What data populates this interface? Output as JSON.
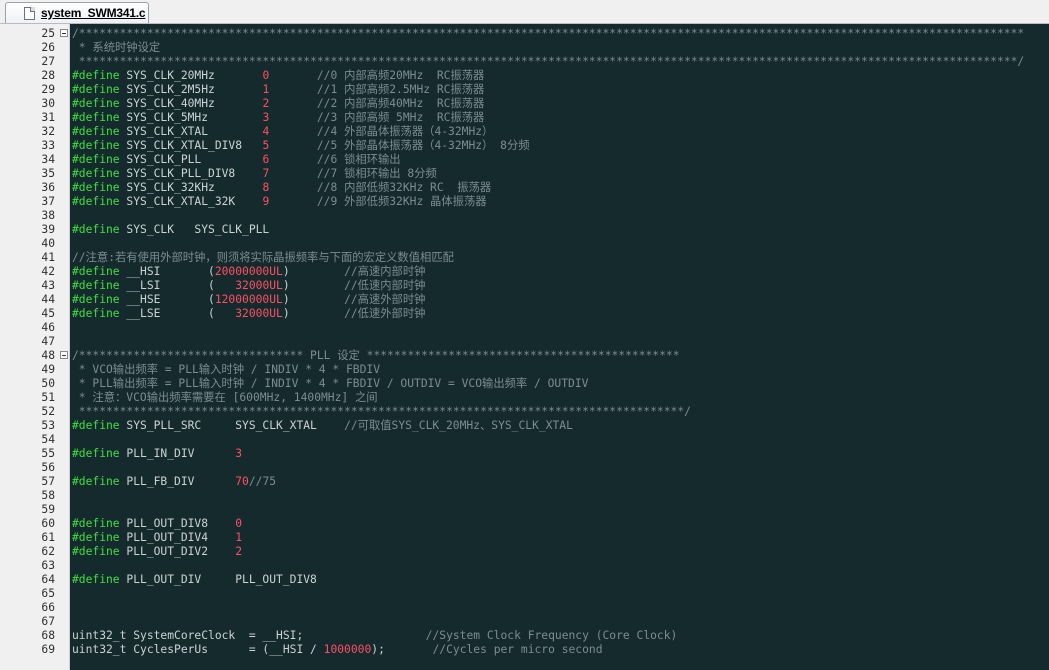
{
  "tab": {
    "filename": "system_SWM341.c"
  },
  "lines": [
    {
      "n": "25",
      "fold": true,
      "segs": [
        [
          "cm",
          "/*******************************************************************************************************************************************"
        ]
      ]
    },
    {
      "n": "26",
      "segs": [
        [
          "cm",
          " * 系统时钟设定"
        ]
      ]
    },
    {
      "n": "27",
      "segs": [
        [
          "cm",
          " ******************************************************************************************************************************************/"
        ]
      ]
    },
    {
      "n": "28",
      "segs": [
        [
          "kw",
          "#define"
        ],
        [
          "txt",
          " SYS_CLK_20MHz       "
        ],
        [
          "num",
          "0"
        ],
        [
          "cm",
          "       //0 内部高频20MHz  RC振荡器"
        ]
      ]
    },
    {
      "n": "29",
      "segs": [
        [
          "kw",
          "#define"
        ],
        [
          "txt",
          " SYS_CLK_2M5Hz       "
        ],
        [
          "num",
          "1"
        ],
        [
          "cm",
          "       //1 内部高频2.5MHz RC振荡器"
        ]
      ]
    },
    {
      "n": "30",
      "segs": [
        [
          "kw",
          "#define"
        ],
        [
          "txt",
          " SYS_CLK_40MHz       "
        ],
        [
          "num",
          "2"
        ],
        [
          "cm",
          "       //2 内部高频40MHz  RC振荡器"
        ]
      ]
    },
    {
      "n": "31",
      "segs": [
        [
          "kw",
          "#define"
        ],
        [
          "txt",
          " SYS_CLK_5MHz        "
        ],
        [
          "num",
          "3"
        ],
        [
          "cm",
          "       //3 内部高频 5MHz  RC振荡器"
        ]
      ]
    },
    {
      "n": "32",
      "segs": [
        [
          "kw",
          "#define"
        ],
        [
          "txt",
          " SYS_CLK_XTAL        "
        ],
        [
          "num",
          "4"
        ],
        [
          "cm",
          "       //4 外部晶体振荡器（4-32MHz）"
        ]
      ]
    },
    {
      "n": "33",
      "segs": [
        [
          "kw",
          "#define"
        ],
        [
          "txt",
          " SYS_CLK_XTAL_DIV8   "
        ],
        [
          "num",
          "5"
        ],
        [
          "cm",
          "       //5 外部晶体振荡器（4-32MHz） 8分频"
        ]
      ]
    },
    {
      "n": "34",
      "segs": [
        [
          "kw",
          "#define"
        ],
        [
          "txt",
          " SYS_CLK_PLL         "
        ],
        [
          "num",
          "6"
        ],
        [
          "cm",
          "       //6 锁相环输出"
        ]
      ]
    },
    {
      "n": "35",
      "segs": [
        [
          "kw",
          "#define"
        ],
        [
          "txt",
          " SYS_CLK_PLL_DIV8    "
        ],
        [
          "num",
          "7"
        ],
        [
          "cm",
          "       //7 锁相环输出 8分频"
        ]
      ]
    },
    {
      "n": "36",
      "segs": [
        [
          "kw",
          "#define"
        ],
        [
          "txt",
          " SYS_CLK_32KHz       "
        ],
        [
          "num",
          "8"
        ],
        [
          "cm",
          "       //8 内部低频32KHz RC  振荡器"
        ]
      ]
    },
    {
      "n": "37",
      "segs": [
        [
          "kw",
          "#define"
        ],
        [
          "txt",
          " SYS_CLK_XTAL_32K    "
        ],
        [
          "num",
          "9"
        ],
        [
          "cm",
          "       //9 外部低频32KHz 晶体振荡器"
        ]
      ]
    },
    {
      "n": "38",
      "segs": []
    },
    {
      "n": "39",
      "segs": [
        [
          "kw",
          "#define"
        ],
        [
          "txt",
          " SYS_CLK   SYS_CLK_PLL"
        ]
      ]
    },
    {
      "n": "40",
      "segs": []
    },
    {
      "n": "41",
      "segs": [
        [
          "cm",
          "//注意:若有使用外部时钟，则须将实际晶振频率与下面的宏定义数值相匹配"
        ]
      ]
    },
    {
      "n": "42",
      "segs": [
        [
          "kw",
          "#define"
        ],
        [
          "txt",
          " __HSI       ("
        ],
        [
          "num",
          "20000000UL"
        ],
        [
          "txt",
          ")"
        ],
        [
          "cm",
          "        //高速内部时钟"
        ]
      ]
    },
    {
      "n": "43",
      "segs": [
        [
          "kw",
          "#define"
        ],
        [
          "txt",
          " __LSI       (   "
        ],
        [
          "num",
          "32000UL"
        ],
        [
          "txt",
          ")"
        ],
        [
          "cm",
          "        //低速内部时钟"
        ]
      ]
    },
    {
      "n": "44",
      "segs": [
        [
          "kw",
          "#define"
        ],
        [
          "txt",
          " __HSE       ("
        ],
        [
          "num",
          "12000000UL"
        ],
        [
          "txt",
          ")"
        ],
        [
          "cm",
          "        //高速外部时钟"
        ]
      ]
    },
    {
      "n": "45",
      "segs": [
        [
          "kw",
          "#define"
        ],
        [
          "txt",
          " __LSE       (   "
        ],
        [
          "num",
          "32000UL"
        ],
        [
          "txt",
          ")"
        ],
        [
          "cm",
          "        //低速外部时钟"
        ]
      ]
    },
    {
      "n": "46",
      "segs": []
    },
    {
      "n": "47",
      "segs": []
    },
    {
      "n": "48",
      "fold": true,
      "segs": [
        [
          "cm",
          "/********************************* PLL 设定 **********************************************"
        ]
      ]
    },
    {
      "n": "49",
      "segs": [
        [
          "cm",
          " * VCO输出频率 = PLL输入时钟 / INDIV * 4 * FBDIV"
        ]
      ]
    },
    {
      "n": "50",
      "segs": [
        [
          "cm",
          " * PLL输出频率 = PLL输入时钟 / INDIV * 4 * FBDIV / OUTDIV = VCO输出频率 / OUTDIV"
        ]
      ]
    },
    {
      "n": "51",
      "segs": [
        [
          "cm",
          " * 注意：VCO输出频率需要在 [600MHz, 1400MHz] 之间"
        ]
      ]
    },
    {
      "n": "52",
      "segs": [
        [
          "cm",
          " *****************************************************************************************/"
        ]
      ]
    },
    {
      "n": "53",
      "segs": [
        [
          "kw",
          "#define"
        ],
        [
          "txt",
          " SYS_PLL_SRC     SYS_CLK_XTAL"
        ],
        [
          "cm",
          "    //可取值SYS_CLK_20MHz、SYS_CLK_XTAL"
        ]
      ]
    },
    {
      "n": "54",
      "segs": []
    },
    {
      "n": "55",
      "segs": [
        [
          "kw",
          "#define"
        ],
        [
          "txt",
          " PLL_IN_DIV      "
        ],
        [
          "num",
          "3"
        ]
      ]
    },
    {
      "n": "56",
      "segs": []
    },
    {
      "n": "57",
      "segs": [
        [
          "kw",
          "#define"
        ],
        [
          "txt",
          " PLL_FB_DIV      "
        ],
        [
          "num",
          "70"
        ],
        [
          "cm",
          "//75"
        ]
      ]
    },
    {
      "n": "58",
      "segs": []
    },
    {
      "n": "59",
      "segs": []
    },
    {
      "n": "60",
      "segs": [
        [
          "kw",
          "#define"
        ],
        [
          "txt",
          " PLL_OUT_DIV8    "
        ],
        [
          "num",
          "0"
        ]
      ]
    },
    {
      "n": "61",
      "segs": [
        [
          "kw",
          "#define"
        ],
        [
          "txt",
          " PLL_OUT_DIV4    "
        ],
        [
          "num",
          "1"
        ]
      ]
    },
    {
      "n": "62",
      "segs": [
        [
          "kw",
          "#define"
        ],
        [
          "txt",
          " PLL_OUT_DIV2    "
        ],
        [
          "num",
          "2"
        ]
      ]
    },
    {
      "n": "63",
      "segs": []
    },
    {
      "n": "64",
      "segs": [
        [
          "kw",
          "#define"
        ],
        [
          "txt",
          " PLL_OUT_DIV     PLL_OUT_DIV8"
        ]
      ]
    },
    {
      "n": "65",
      "segs": []
    },
    {
      "n": "66",
      "segs": []
    },
    {
      "n": "67",
      "segs": []
    },
    {
      "n": "68",
      "segs": [
        [
          "txt",
          "uint32_t SystemCoreClock  = __HSI;"
        ],
        [
          "cm",
          "                  //System Clock Frequency (Core Clock)"
        ]
      ]
    },
    {
      "n": "69",
      "segs": [
        [
          "txt",
          "uint32_t CyclesPerUs      = (__HSI / "
        ],
        [
          "num",
          "1000000"
        ],
        [
          "txt",
          ");"
        ],
        [
          "cm",
          "       //Cycles per micro second"
        ]
      ]
    }
  ]
}
